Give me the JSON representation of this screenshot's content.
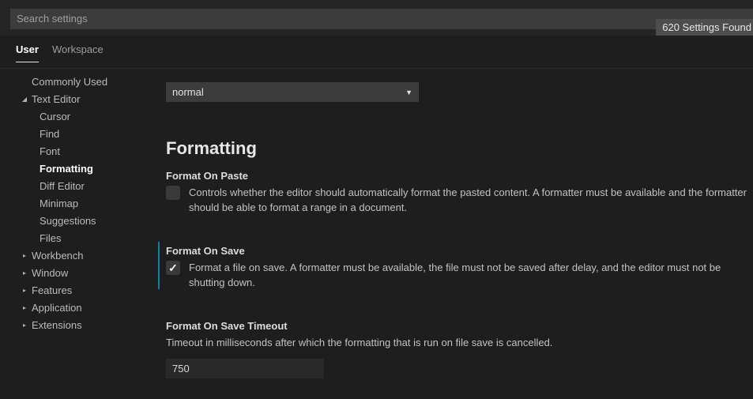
{
  "search": {
    "placeholder": "Search settings",
    "value": "",
    "results_badge": "620 Settings Found"
  },
  "tabs": [
    {
      "label": "User",
      "active": true
    },
    {
      "label": "Workspace",
      "active": false
    }
  ],
  "sidebar": {
    "items": [
      {
        "label": "Commonly Used",
        "level": 0,
        "twisty": "",
        "selected": false
      },
      {
        "label": "Text Editor",
        "level": 0,
        "twisty": "expanded",
        "selected": false
      },
      {
        "label": "Cursor",
        "level": 1,
        "twisty": "",
        "selected": false
      },
      {
        "label": "Find",
        "level": 1,
        "twisty": "",
        "selected": false
      },
      {
        "label": "Font",
        "level": 1,
        "twisty": "",
        "selected": false
      },
      {
        "label": "Formatting",
        "level": 1,
        "twisty": "",
        "selected": true
      },
      {
        "label": "Diff Editor",
        "level": 1,
        "twisty": "",
        "selected": false
      },
      {
        "label": "Minimap",
        "level": 1,
        "twisty": "",
        "selected": false
      },
      {
        "label": "Suggestions",
        "level": 1,
        "twisty": "",
        "selected": false
      },
      {
        "label": "Files",
        "level": 1,
        "twisty": "",
        "selected": false
      },
      {
        "label": "Workbench",
        "level": 0,
        "twisty": "collapsed",
        "selected": false
      },
      {
        "label": "Window",
        "level": 0,
        "twisty": "collapsed",
        "selected": false
      },
      {
        "label": "Features",
        "level": 0,
        "twisty": "collapsed",
        "selected": false
      },
      {
        "label": "Application",
        "level": 0,
        "twisty": "collapsed",
        "selected": false
      },
      {
        "label": "Extensions",
        "level": 0,
        "twisty": "collapsed",
        "selected": false
      }
    ],
    "twisty_glyphs": {
      "expanded": "◢",
      "collapsed": "▸"
    }
  },
  "content": {
    "top_select": {
      "value": "normal",
      "arrow": "▼"
    },
    "section_heading": "Formatting",
    "settings": [
      {
        "title": "Format On Paste",
        "description": "Controls whether the editor should automatically format the pasted content. A formatter must be available and the formatter should be able to format a range in a document.",
        "checked": false,
        "modified": false,
        "check_glyph": ""
      },
      {
        "title": "Format On Save",
        "description": "Format a file on save. A formatter must be available, the file must not be saved after delay, and the editor must not be shutting down.",
        "checked": true,
        "modified": true,
        "check_glyph": "✓"
      },
      {
        "title": "Format On Save Timeout",
        "description": "Timeout in milliseconds after which the formatting that is run on file save is cancelled.",
        "value": "750",
        "modified": false
      }
    ]
  },
  "colors": {
    "background": "#1e1e1e",
    "header_background": "#252526",
    "input_background": "#3c3c3c",
    "modified_indicator": "#0e83a8",
    "active_tab_text": "#ffffff",
    "badge_background": "#4d4d4d"
  }
}
